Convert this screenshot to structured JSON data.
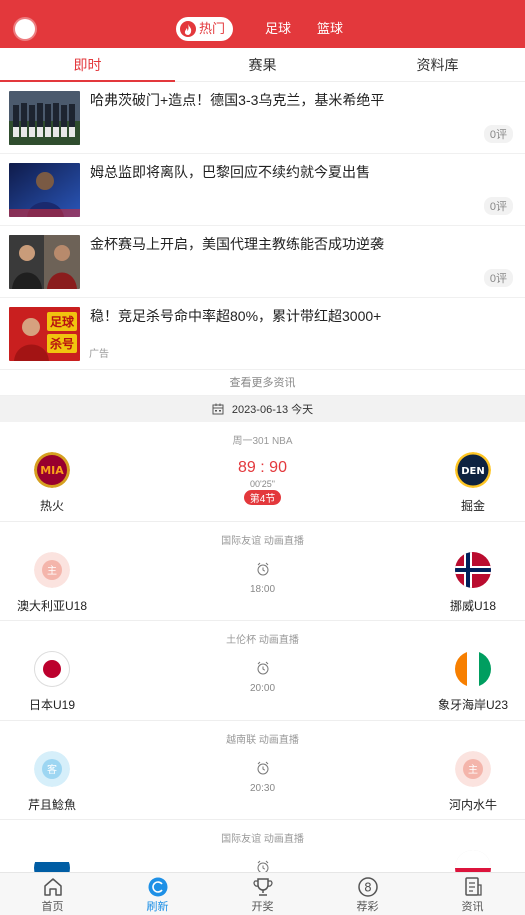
{
  "header": {
    "top_tabs": [
      "热门",
      "足球",
      "篮球"
    ]
  },
  "subtabs": [
    "即时",
    "赛果",
    "资料库"
  ],
  "news": [
    {
      "title": "哈弗茨破门+造点！德国3-3乌克兰，基米希绝平",
      "comments": "0评"
    },
    {
      "title": "姆总监即将离队，巴黎回应不续约就今夏出售",
      "comments": "0评"
    },
    {
      "title": "金杯赛马上开启，美国代理主教练能否成功逆袭",
      "comments": "0评"
    },
    {
      "title": "稳！竞足杀号命中率超80%，累计带红超3000+",
      "tag": "广告",
      "thumb_text": "足球\n杀号"
    }
  ],
  "more_news": "查看更多资讯",
  "date_label": "2023-06-13 今天",
  "matches": [
    {
      "league": "周一301 NBA",
      "home": "热火",
      "away": "掘金",
      "home_logo_text": "MIA",
      "away_logo_text": "DEN",
      "score": "89 : 90",
      "time": "00'25\"",
      "period": "第4节"
    },
    {
      "league": "国际友谊 动画直播",
      "home": "澳大利亚U18",
      "away": "挪威U18",
      "home_logo_text": "主",
      "kickoff": "18:00"
    },
    {
      "league": "土伦杯 动画直播",
      "home": "日本U19",
      "away": "象牙海岸U23",
      "kickoff": "20:00"
    },
    {
      "league": "越南联 动画直播",
      "home": "芹且鯰魚",
      "away": "河内水牛",
      "home_logo_text": "客",
      "away_logo_text": "主",
      "kickoff": "20:30"
    },
    {
      "league": "国际友谊 动画直播"
    }
  ],
  "bottom_nav": [
    "首页",
    "刷新",
    "开奖",
    "荐彩",
    "资讯"
  ],
  "colors": {
    "brand": "#e3383c",
    "active_nav": "#1e90e6"
  }
}
